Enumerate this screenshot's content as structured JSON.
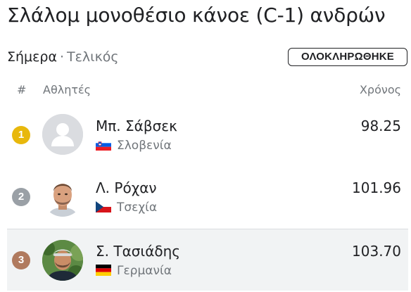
{
  "title": "Σλάλομ μονοθέσιο κάνοε (C-1) ανδρών",
  "subtitle": {
    "day": "Σήμερα",
    "separator": "·",
    "phase": "Τελικός"
  },
  "status_badge": "ΟΛΟΚΛΗΡΩΘΗΚΕ",
  "table": {
    "columns": {
      "rank": "#",
      "athletes": "Αθλητές",
      "time": "Χρόνος"
    },
    "rows": [
      {
        "rank": "1",
        "name": "Μπ. Σάβσεκ",
        "country": "Σλοβενία",
        "time": "98.25",
        "medal_color": "#e8b80c",
        "flag": "slovenia-flag-icon",
        "avatar": "default-person-avatar-icon"
      },
      {
        "rank": "2",
        "name": "Λ. Ρόχαν",
        "country": "Τσεχία",
        "time": "101.96",
        "medal_color": "#9aa0a6",
        "flag": "czechia-flag-icon",
        "avatar": "athlete-photo"
      },
      {
        "rank": "3",
        "name": "Σ. Τασιάδης",
        "country": "Γερμανία",
        "time": "103.70",
        "medal_color": "#b07a5e",
        "flag": "germany-flag-icon",
        "avatar": "athlete-photo"
      }
    ]
  },
  "colors": {
    "text_primary": "#202124",
    "text_secondary": "#70757a",
    "row_highlight": "#f1f3f4",
    "gold": "#e8b80c",
    "silver": "#9aa0a6",
    "bronze": "#b07a5e"
  }
}
